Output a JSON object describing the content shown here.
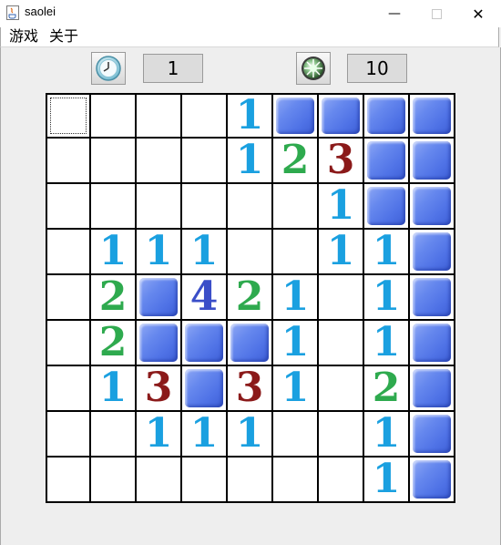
{
  "window": {
    "title": "saolei"
  },
  "menu": [
    {
      "label": "游戏"
    },
    {
      "label": "关于"
    }
  ],
  "toolbar": {
    "timer_icon": "clock-icon",
    "time_value": "1",
    "mine_icon": "mine-icon",
    "mine_count": "10"
  },
  "colors": {
    "1": "#1aa0e0",
    "2": "#2eaa4e",
    "3": "#8b1a1a",
    "4": "#3a4ec8",
    "tile": "#5a7cec"
  },
  "board": {
    "rows": [
      [
        "",
        "",
        "",
        "",
        "1",
        "#",
        "#",
        "#",
        "#"
      ],
      [
        "",
        "",
        "",
        "",
        "1",
        "2",
        "3",
        "#",
        "#"
      ],
      [
        "",
        "",
        "",
        "",
        "",
        "",
        "1",
        "#",
        "#"
      ],
      [
        "",
        "1",
        "1",
        "1",
        "",
        "",
        "1",
        "1",
        "#"
      ],
      [
        "",
        "2",
        "#",
        "4",
        "2",
        "1",
        "",
        "1",
        "#"
      ],
      [
        "",
        "2",
        "#",
        "#",
        "#",
        "1",
        "",
        "1",
        "#"
      ],
      [
        "",
        "1",
        "3",
        "#",
        "3",
        "1",
        "",
        "2",
        "#"
      ],
      [
        "",
        "",
        "1",
        "1",
        "1",
        "",
        "",
        "1",
        "#"
      ],
      [
        "",
        "",
        "",
        "",
        "",
        "",
        "",
        "1",
        "#"
      ]
    ]
  }
}
